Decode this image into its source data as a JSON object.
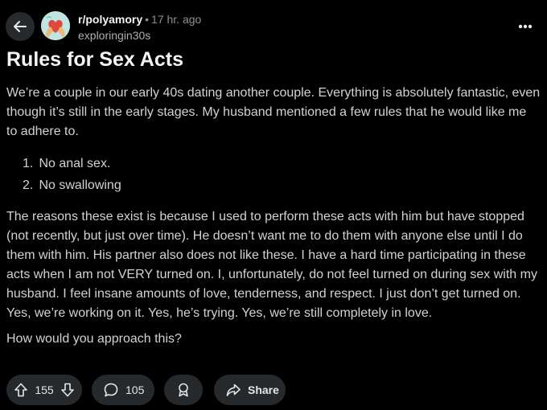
{
  "header": {
    "subreddit": "r/polyamory",
    "separator": "•",
    "time": "17 hr. ago",
    "author": "exploringin30s"
  },
  "post": {
    "title": "Rules for Sex Acts",
    "paragraph1": "We’re a couple in our early 40s dating another couple. Everything is absolutely fantastic, even though it’s still in the early stages. My husband mentioned a few rules that he would like me to adhere to.",
    "list": [
      {
        "num": "1.",
        "text": "No anal sex."
      },
      {
        "num": "2.",
        "text": "No swallowing"
      }
    ],
    "paragraph2": "The reasons these exist is because I used to perform these acts with him but have stopped (not recently, but just over time). He doesn’t want me to do them with anyone else until I do them with him. His partner also does not like these. I have a hard time participating in these acts when I am not VERY turned on. I, unfortunately, do not feel turned on during sex with my husband. I feel insane amounts of love, tenderness, and respect. I just don’t get turned on. Yes, we’re working on it. Yes, he’s trying. Yes, we’re still completely in love.",
    "paragraph3": "How would you approach this?"
  },
  "actions": {
    "upvotes": "155",
    "comments": "105",
    "share_label": "Share"
  },
  "icons": {
    "back": "arrow-left-icon",
    "more": "more-horizontal-icon",
    "upvote": "upvote-arrow-icon",
    "downvote": "downvote-arrow-icon",
    "comment": "comment-bubble-icon",
    "award": "award-icon",
    "share": "share-arrow-icon"
  },
  "colors": {
    "background": "#000000",
    "pill": "#26292c",
    "text": "#d7dadc",
    "muted": "#8b9196"
  }
}
